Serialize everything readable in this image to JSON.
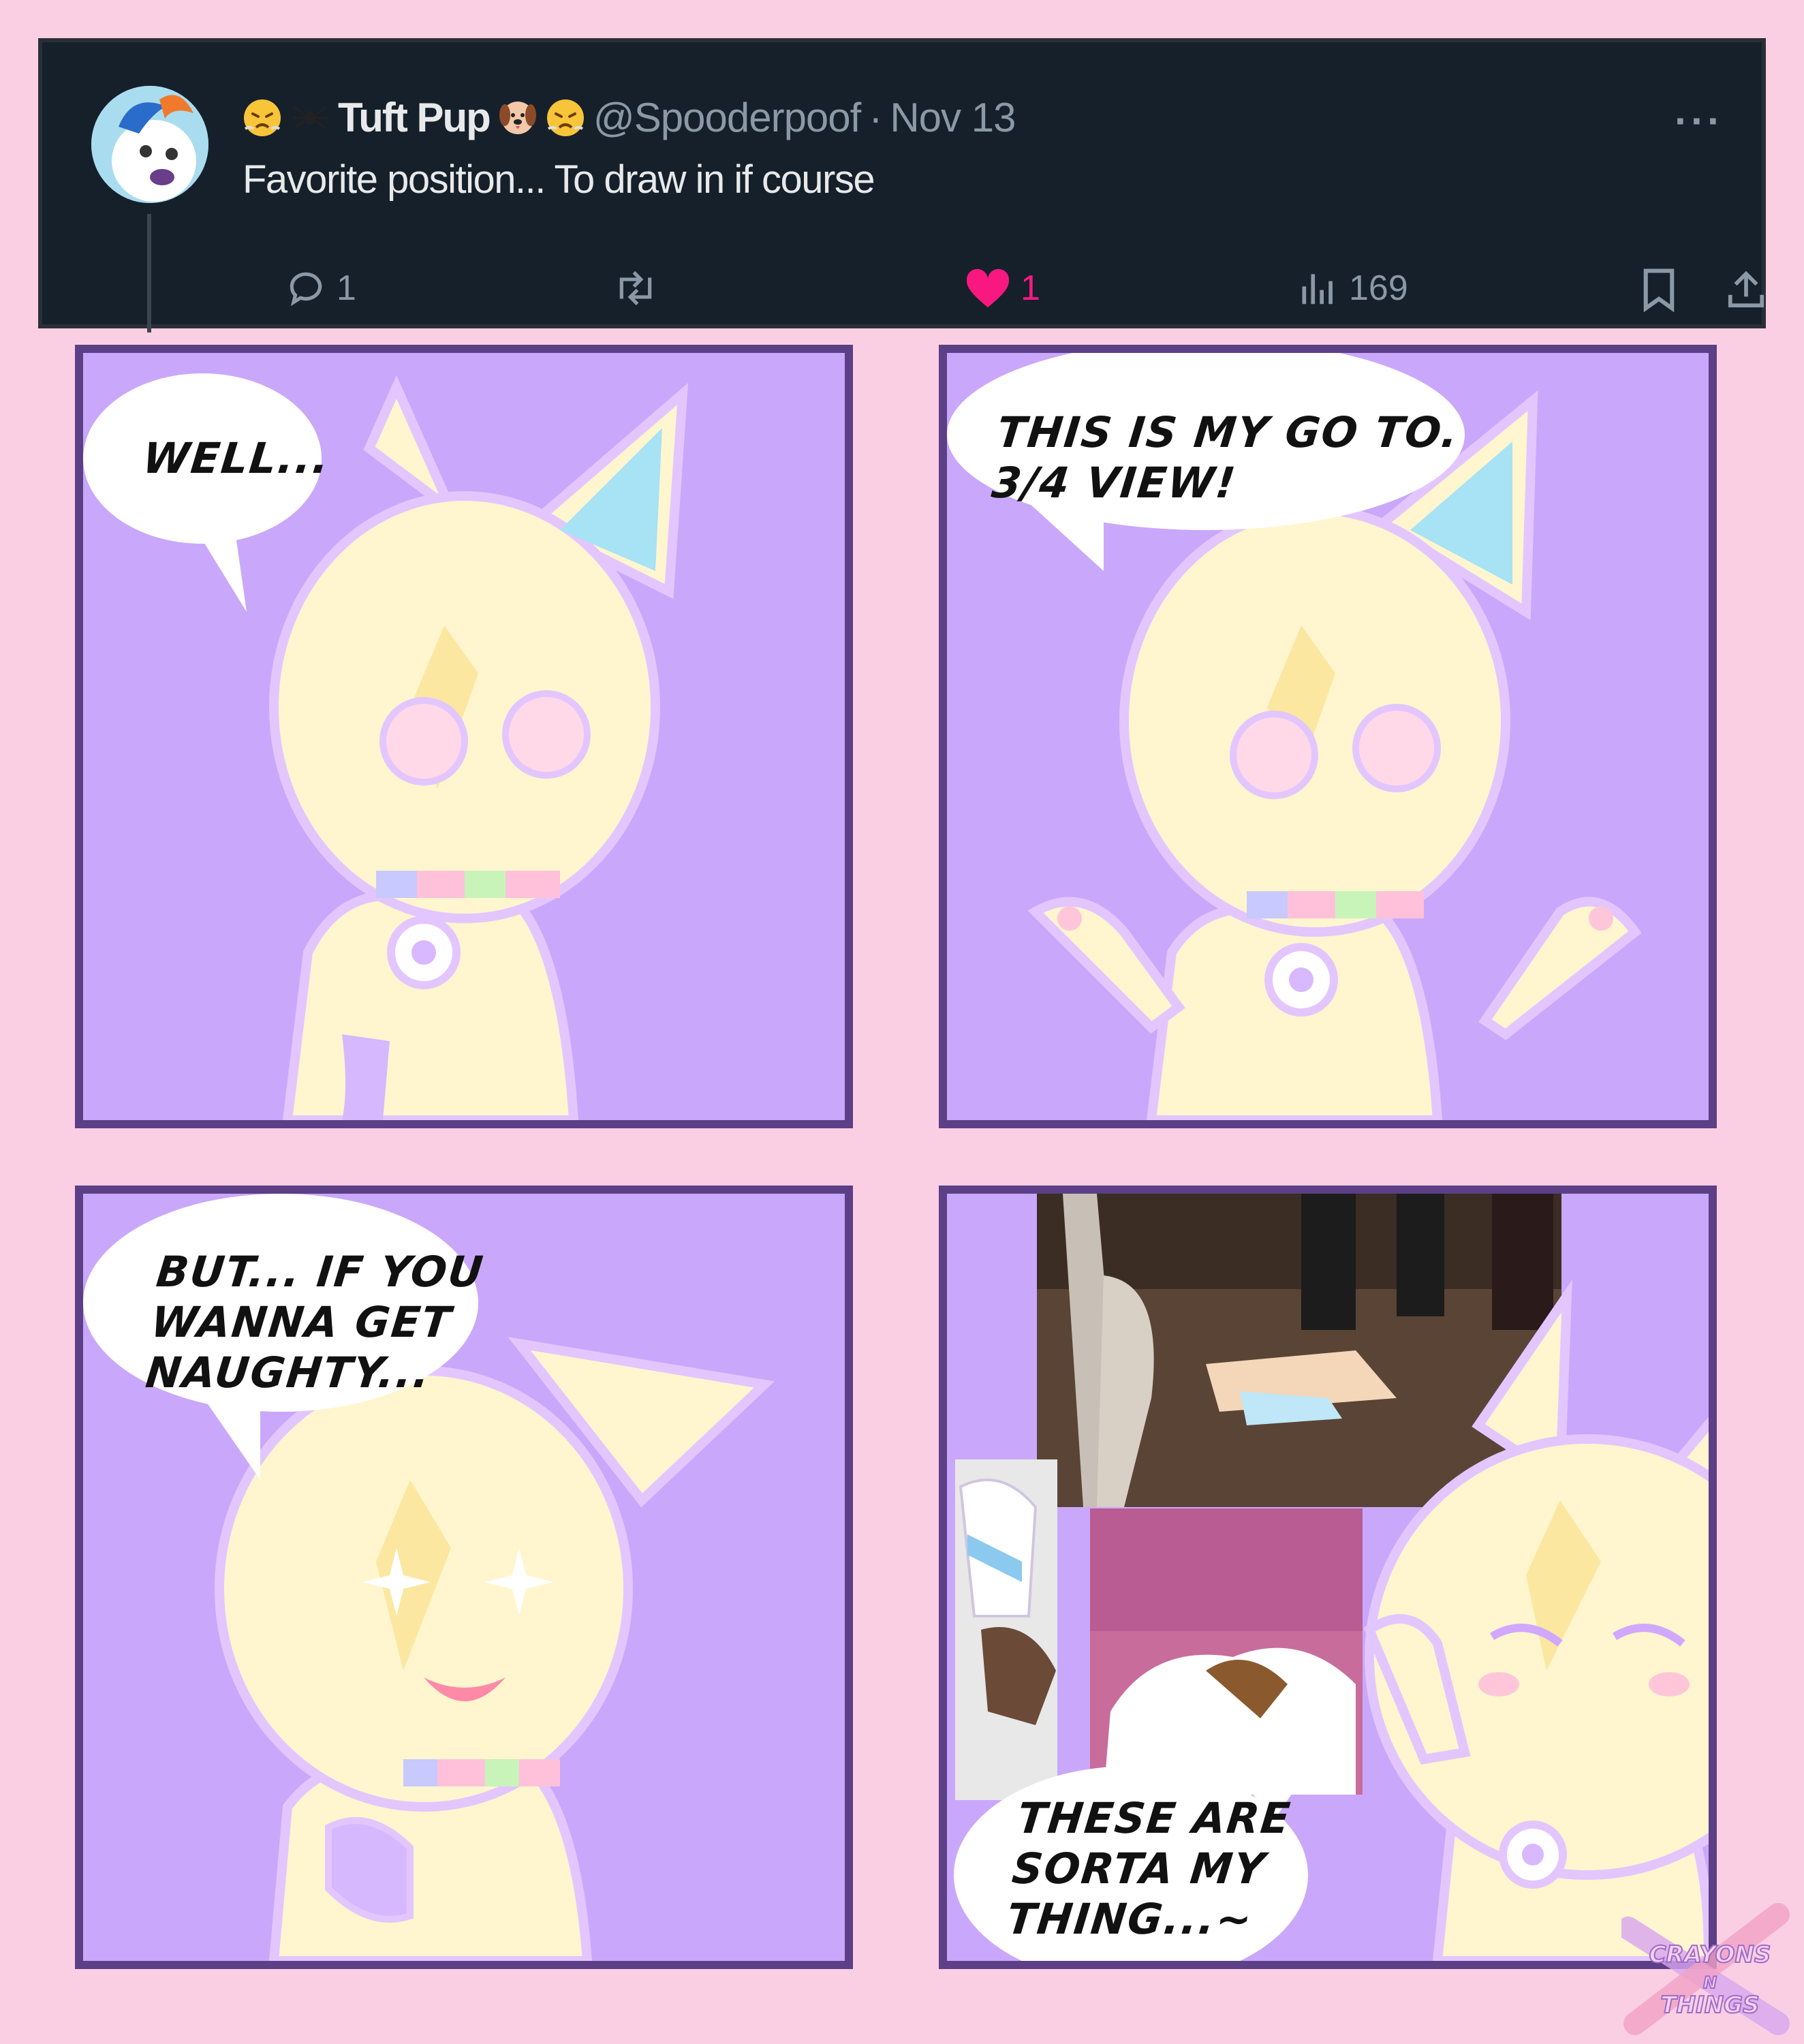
{
  "tweet": {
    "display_name": "Tuft Pup",
    "handle": "@Spooderpoof",
    "separator": "·",
    "date": "Nov 13",
    "more_icon": "more-options-icon",
    "text": "Favorite position... To draw in if course",
    "actions": {
      "reply_count": "1",
      "retweet_count": "",
      "like_count": "1",
      "view_count": "169"
    },
    "colors": {
      "background": "#15202b",
      "text": "#e7e9ea",
      "muted": "#8b98a5",
      "like": "#f91880"
    }
  },
  "comic": {
    "panels": [
      {
        "bubble": "WELL..."
      },
      {
        "bubble": "THIS IS MY GO TO.\n3/4 VIEW!"
      },
      {
        "bubble": "BUT... IF YOU\nWANNA GET\nNAUGHTY..."
      },
      {
        "bubble": "THESE ARE\nSORTA MY\nTHING...~"
      }
    ],
    "colors": {
      "page": "#fbcfe3",
      "panel_bg": "#c9a8fb",
      "border": "#5c3f86",
      "character": "#fff6cf"
    }
  },
  "watermark": {
    "text": "CRAYONS N THINGS"
  }
}
